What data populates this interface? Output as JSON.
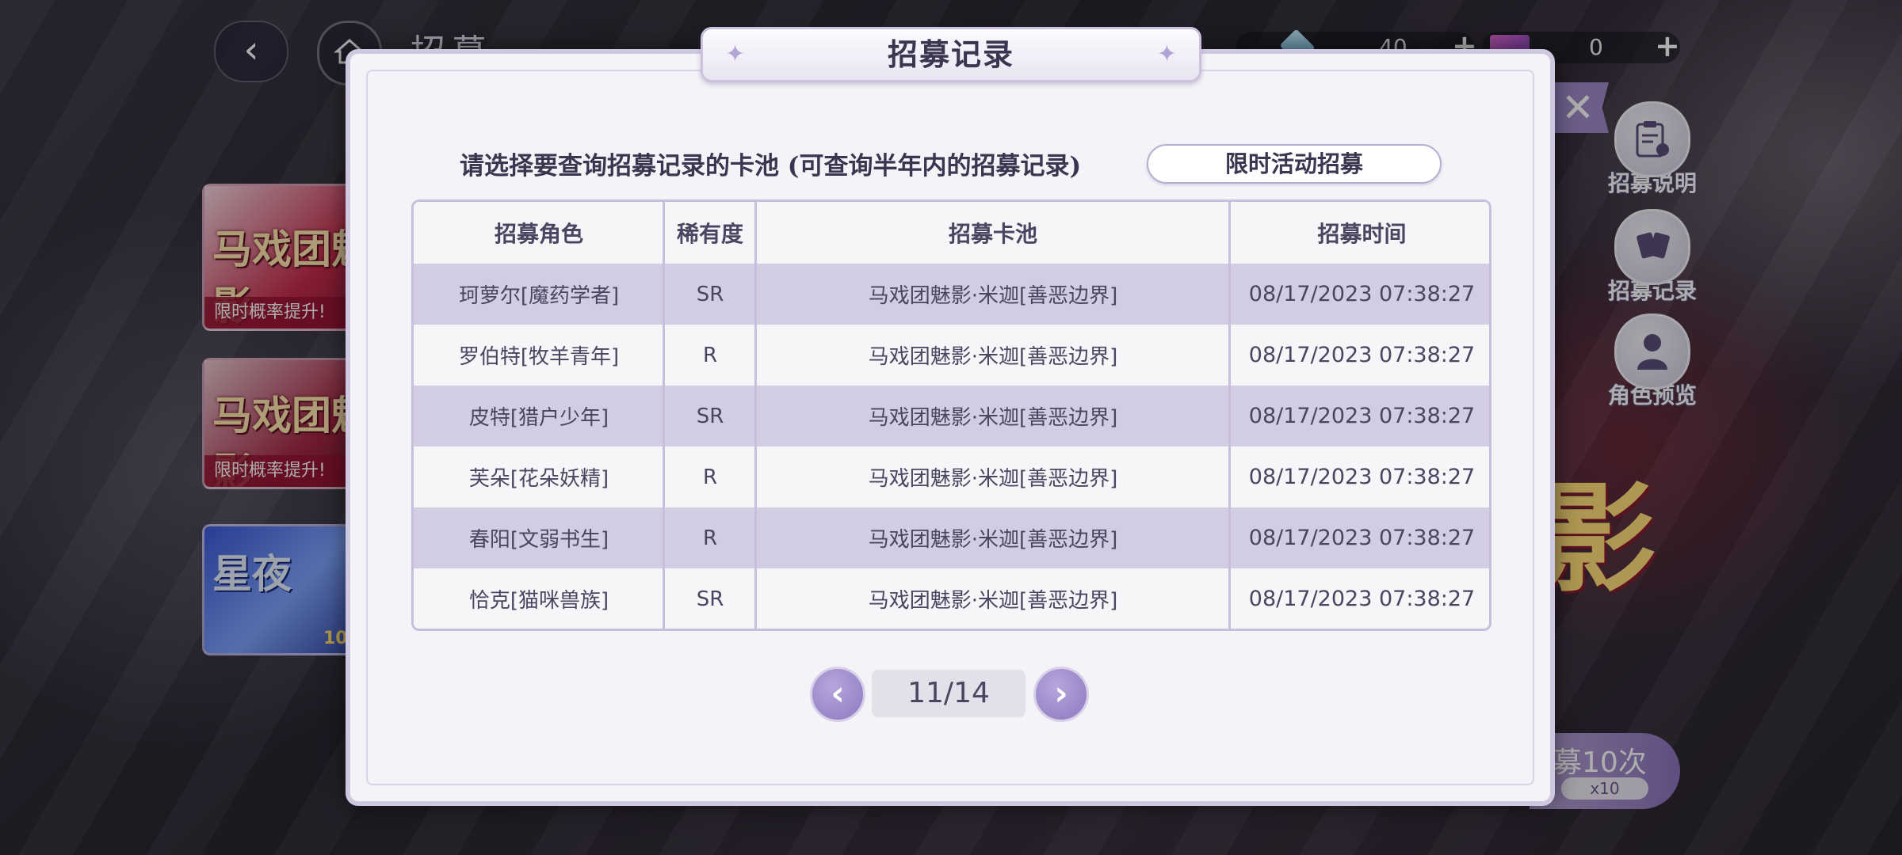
{
  "header": {
    "title": "招募",
    "currency_1_value": "40",
    "currency_2_value": "0",
    "back_icon": "chevron-left-icon",
    "home_icon": "home-icon"
  },
  "banners": [
    {
      "art_text": "马戏团魅影",
      "tag": "限时概率提升!"
    },
    {
      "art_text": "马戏团魅影",
      "tag": "限时概率提升!"
    },
    {
      "art_text": "星夜",
      "tag": "10"
    }
  ],
  "side_menu": [
    {
      "label": "招募说明",
      "icon": "clipboard-icon"
    },
    {
      "label": "招募记录",
      "icon": "cards-icon"
    },
    {
      "label": "角色预览",
      "icon": "person-icon"
    }
  ],
  "bottom_right": {
    "recruit_label": "募10次",
    "cost": "x10",
    "emblem_text": "影"
  },
  "modal": {
    "title": "招募记录",
    "prompt": "请选择要查询招募记录的卡池 (可查询半年内的招募记录)",
    "pool_select_value": "限时活动招募",
    "columns": [
      "招募角色",
      "稀有度",
      "招募卡池",
      "招募时间"
    ],
    "rows": [
      {
        "character": "珂萝尔[魔药学者]",
        "rarity": "SR",
        "pool": "马戏团魅影·米迦[善恶边界]",
        "time": "08/17/2023 07:38:27"
      },
      {
        "character": "罗伯特[牧羊青年]",
        "rarity": "R",
        "pool": "马戏团魅影·米迦[善恶边界]",
        "time": "08/17/2023 07:38:27"
      },
      {
        "character": "皮特[猎户少年]",
        "rarity": "SR",
        "pool": "马戏团魅影·米迦[善恶边界]",
        "time": "08/17/2023 07:38:27"
      },
      {
        "character": "芙朵[花朵妖精]",
        "rarity": "R",
        "pool": "马戏团魅影·米迦[善恶边界]",
        "time": "08/17/2023 07:38:27"
      },
      {
        "character": "春阳[文弱书生]",
        "rarity": "R",
        "pool": "马戏团魅影·米迦[善恶边界]",
        "time": "08/17/2023 07:38:27"
      },
      {
        "character": "恰克[猫咪兽族]",
        "rarity": "SR",
        "pool": "马戏团魅影·米迦[善恶边界]",
        "time": "08/17/2023 07:38:27"
      }
    ],
    "pagination": {
      "page": "11/14",
      "prev_icon": "chevron-left-icon",
      "next_icon": "chevron-right-icon"
    },
    "close_icon": "close-icon"
  },
  "colors": {
    "accent": "#9a86c6",
    "row_shade": "#d2cde3",
    "panel": "#f4f3f7"
  }
}
